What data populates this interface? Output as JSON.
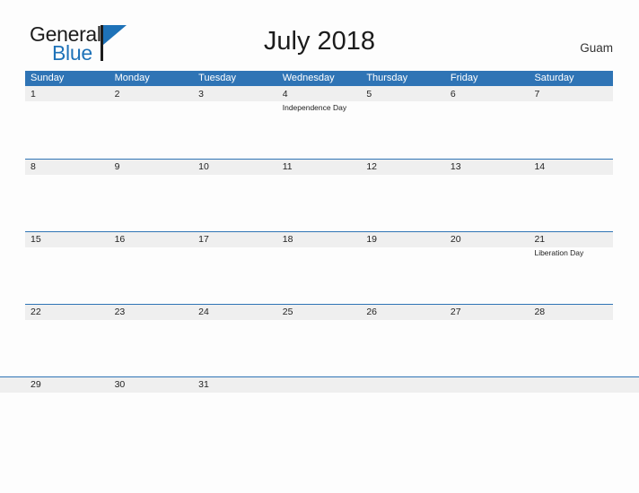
{
  "brand": {
    "name_part1": "General",
    "name_part2": "Blue",
    "flag_icon": "flag-triangle-icon"
  },
  "header": {
    "title": "July 2018",
    "location": "Guam"
  },
  "colors": {
    "header_blue": "#2f74b5",
    "band_gray": "#efefef",
    "logo_blue": "#1e72b8",
    "page_background": "#fdfdfd",
    "text": "#222222"
  },
  "calendar": {
    "weekdays": [
      "Sunday",
      "Monday",
      "Tuesday",
      "Wednesday",
      "Thursday",
      "Friday",
      "Saturday"
    ],
    "weeks": [
      [
        {
          "date": "1",
          "event": ""
        },
        {
          "date": "2",
          "event": ""
        },
        {
          "date": "3",
          "event": ""
        },
        {
          "date": "4",
          "event": "Independence Day"
        },
        {
          "date": "5",
          "event": ""
        },
        {
          "date": "6",
          "event": ""
        },
        {
          "date": "7",
          "event": ""
        }
      ],
      [
        {
          "date": "8",
          "event": ""
        },
        {
          "date": "9",
          "event": ""
        },
        {
          "date": "10",
          "event": ""
        },
        {
          "date": "11",
          "event": ""
        },
        {
          "date": "12",
          "event": ""
        },
        {
          "date": "13",
          "event": ""
        },
        {
          "date": "14",
          "event": ""
        }
      ],
      [
        {
          "date": "15",
          "event": ""
        },
        {
          "date": "16",
          "event": ""
        },
        {
          "date": "17",
          "event": ""
        },
        {
          "date": "18",
          "event": ""
        },
        {
          "date": "19",
          "event": ""
        },
        {
          "date": "20",
          "event": ""
        },
        {
          "date": "21",
          "event": "Liberation Day"
        }
      ],
      [
        {
          "date": "22",
          "event": ""
        },
        {
          "date": "23",
          "event": ""
        },
        {
          "date": "24",
          "event": ""
        },
        {
          "date": "25",
          "event": ""
        },
        {
          "date": "26",
          "event": ""
        },
        {
          "date": "27",
          "event": ""
        },
        {
          "date": "28",
          "event": ""
        }
      ],
      [
        {
          "date": "29",
          "event": ""
        },
        {
          "date": "30",
          "event": ""
        },
        {
          "date": "31",
          "event": ""
        },
        {
          "date": "",
          "event": ""
        },
        {
          "date": "",
          "event": ""
        },
        {
          "date": "",
          "event": ""
        },
        {
          "date": "",
          "event": ""
        }
      ]
    ]
  }
}
